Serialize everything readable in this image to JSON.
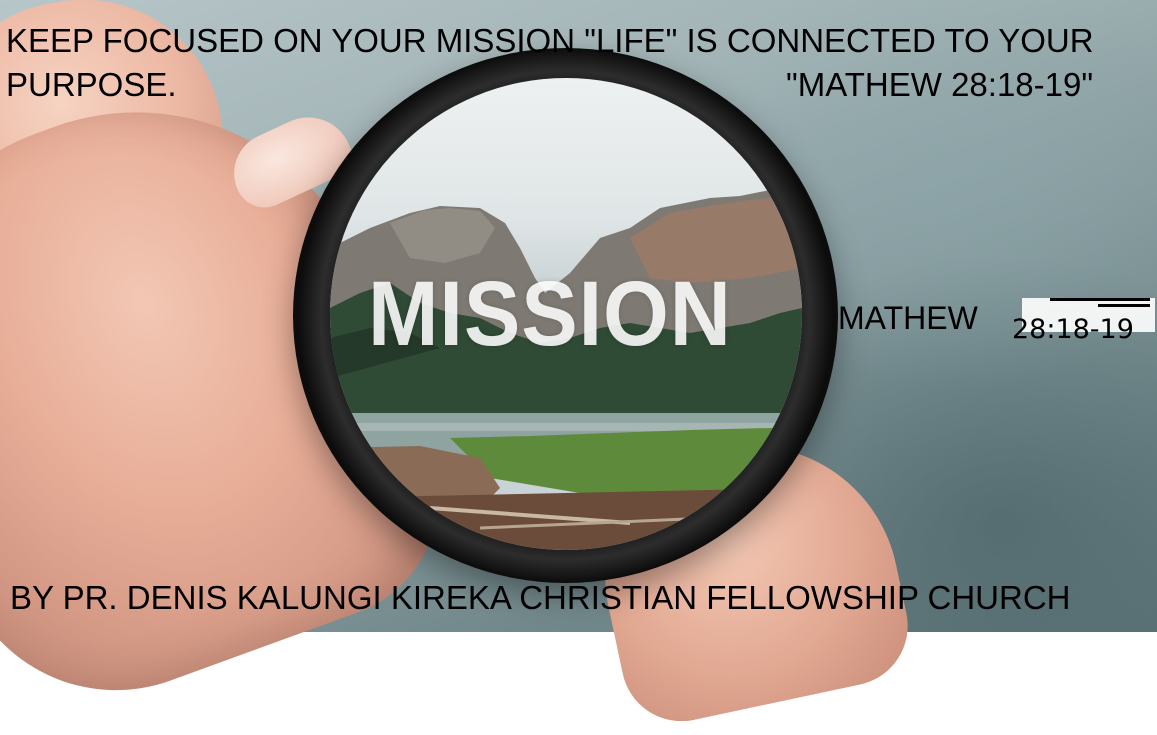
{
  "header": {
    "line1": "KEEP FOCUSED ON YOUR MISSION \"LIFE\" IS CONNECTED TO YOUR",
    "line2": "PURPOSE.",
    "scripture_reference": "\"MATHEW 28:18-19\""
  },
  "lens": {
    "overlay_word": "MISSION"
  },
  "side_reference": {
    "book": "MATHEW",
    "verse": "28:18-19"
  },
  "footer": {
    "credit": "BY PR. DENIS KALUNGI KIREKA CHRISTIAN FELLOWSHIP CHURCH"
  },
  "colors": {
    "text": "#000000",
    "overlay_text": "#ffffff",
    "lens_frame": "#111111",
    "background": "#9fb1b3"
  }
}
